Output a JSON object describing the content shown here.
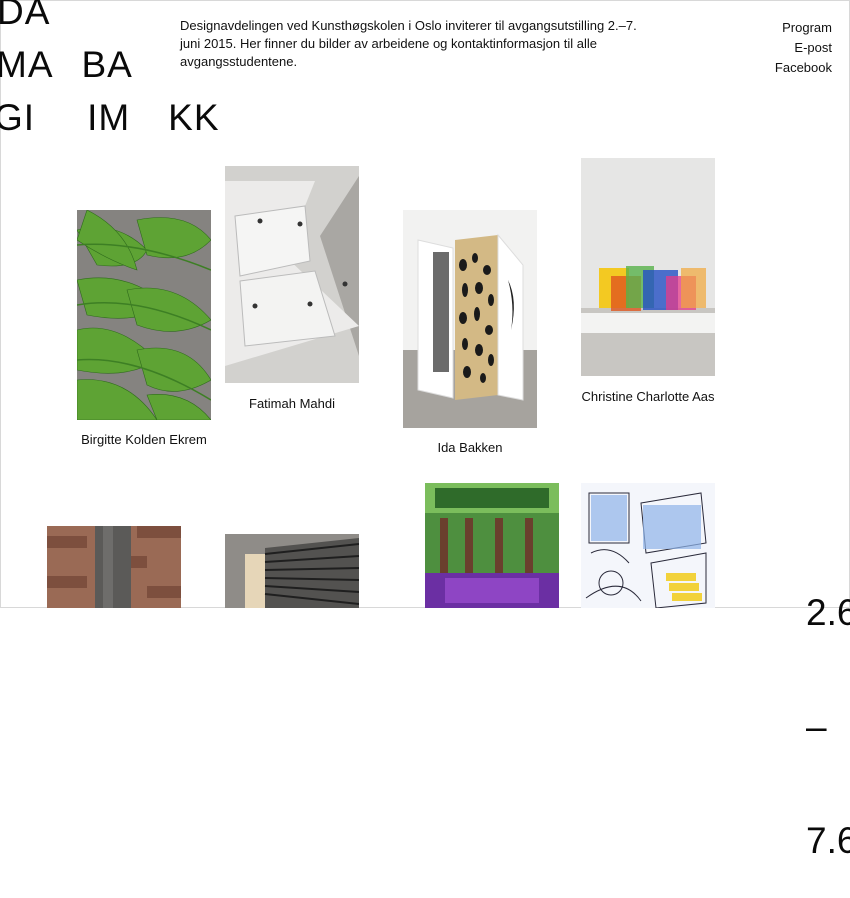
{
  "logo": {
    "row1": [
      "DA"
    ],
    "row2": [
      "MA",
      "BA"
    ],
    "row3": [
      "GI",
      "IM",
      "KK"
    ]
  },
  "intro": "Designavdelingen ved Kunsthøgskolen i Oslo inviterer til avgangsutstilling 2.–7. juni 2015. Her finner du bilder av arbeidene og kontaktinformasjon til alle avgangsstudentene.",
  "nav": {
    "items": [
      "Program",
      "E-post",
      "Facebook"
    ]
  },
  "students": [
    {
      "name": "Birgitte Kolden Ekrem"
    },
    {
      "name": "Fatimah Mahdi"
    },
    {
      "name": "Ida Bakken"
    },
    {
      "name": "Christine Charlotte Aas"
    }
  ],
  "date": {
    "line1": "2.6",
    "line2": "–",
    "line3": "7.6"
  }
}
